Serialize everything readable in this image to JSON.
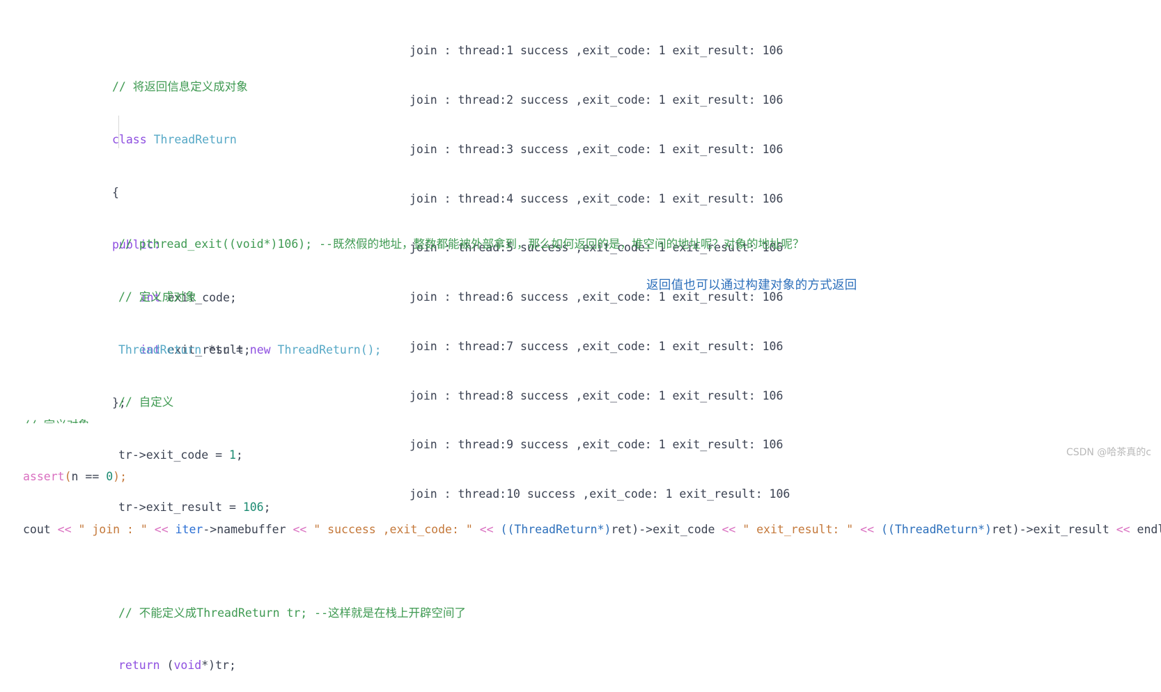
{
  "terminal_output": {
    "lines": [
      "join : thread:1 success ,exit_code: 1 exit_result: 106",
      "join : thread:2 success ,exit_code: 1 exit_result: 106",
      "join : thread:3 success ,exit_code: 1 exit_result: 106",
      "join : thread:4 success ,exit_code: 1 exit_result: 106",
      "join : thread:5 success ,exit_code: 1 exit_result: 106",
      "join : thread:6 success ,exit_code: 1 exit_result: 106",
      "join : thread:7 success ,exit_code: 1 exit_result: 106",
      "join : thread:8 success ,exit_code: 1 exit_result: 106",
      "join : thread:9 success ,exit_code: 1 exit_result: 106",
      "join : thread:10 success ,exit_code: 1 exit_result: 106"
    ]
  },
  "class_block": {
    "comment_header": "// 将返回信息定义成对象",
    "keyword_class": "class",
    "class_name": "ThreadReturn",
    "brace_open": "{",
    "access_public": "public:",
    "field1_type": "int",
    "field1_name": " exit_code;",
    "field2_type": "int",
    "field2_name": " exit_result;",
    "brace_close": "};"
  },
  "middle_block": {
    "comment1": "// pthread_exit((void*)106); --既然假的地址，整数都能被外部拿到，那么如何返回的是，堆空间的地址呢？对象的地址呢？",
    "comment2": "// 定义成对象",
    "alloc_type": "ThreadReturn",
    "alloc_ptr": " *tr = ",
    "alloc_new": "new",
    "alloc_ctor": " ThreadReturn();",
    "comment3": "// 自定义",
    "assign1_lhs": "tr->exit_code = ",
    "assign1_val": "1",
    "assign1_end": ";",
    "assign2_lhs": "tr->exit_result = ",
    "assign2_val": "106",
    "assign2_end": ";",
    "comment4": "// 不能定义成ThreadReturn tr; --这样就是在栈上开辟空间了",
    "return_kw": "return",
    "return_open": " (",
    "return_type": "void",
    "return_star": "*",
    "return_close": ")",
    "return_val": "tr;"
  },
  "bottom_block": {
    "assert_fn": "assert",
    "assert_open": "(",
    "assert_var": "n ",
    "assert_op": "== ",
    "assert_num": "0",
    "assert_close": ");",
    "cout_name": "cout ",
    "cout_op1": "<< ",
    "cout_str1": "\" join : \"",
    "cout_op2": " << ",
    "cout_iter": "iter",
    "cout_arrow1": "->namebuffer ",
    "cout_op3": "<< ",
    "cout_str2": "\" success ,exit_code: \"",
    "cout_op4": " << ",
    "cout_cast1": "((ThreadReturn*)",
    "cout_ret1": "ret)",
    "cout_member1": "->exit_code ",
    "cout_op5": "<< ",
    "cout_str3": "\" exit_result: \"",
    "cout_op6": " << ",
    "cout_cast2": "((ThreadReturn*)",
    "cout_ret2": "ret)",
    "cout_member2": "->exit_result ",
    "cout_op7": "<< ",
    "cout_endl": "endl;"
  },
  "annotation": {
    "text": "返回值也可以通过构建对象的方式返回",
    "color": "#2c6fbb"
  },
  "watermark": {
    "text": "CSDN @哈茶真的c"
  }
}
